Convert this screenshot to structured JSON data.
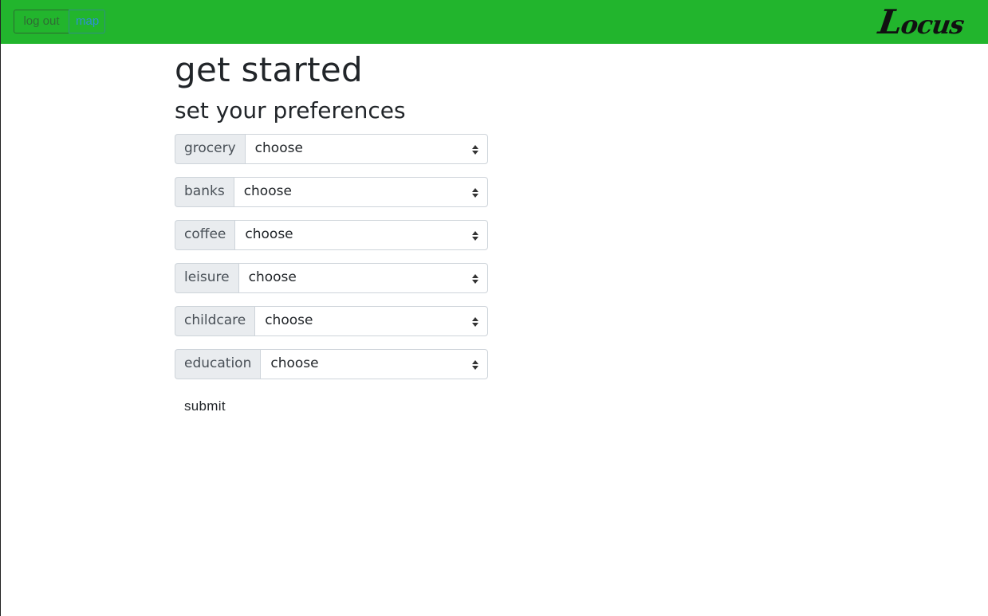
{
  "navbar": {
    "logout_label": "log out",
    "map_label": "map",
    "brand_first": "L",
    "brand_rest": "ocus",
    "bg_color": "#22b52d"
  },
  "page": {
    "title": "get started",
    "subtitle": "set your preferences"
  },
  "preferences": [
    {
      "label": "grocery",
      "value": "choose"
    },
    {
      "label": "banks",
      "value": "choose"
    },
    {
      "label": "coffee",
      "value": "choose"
    },
    {
      "label": "leisure",
      "value": "choose"
    },
    {
      "label": "childcare",
      "value": "choose"
    },
    {
      "label": "education",
      "value": "choose"
    }
  ],
  "form": {
    "submit_label": "submit"
  }
}
